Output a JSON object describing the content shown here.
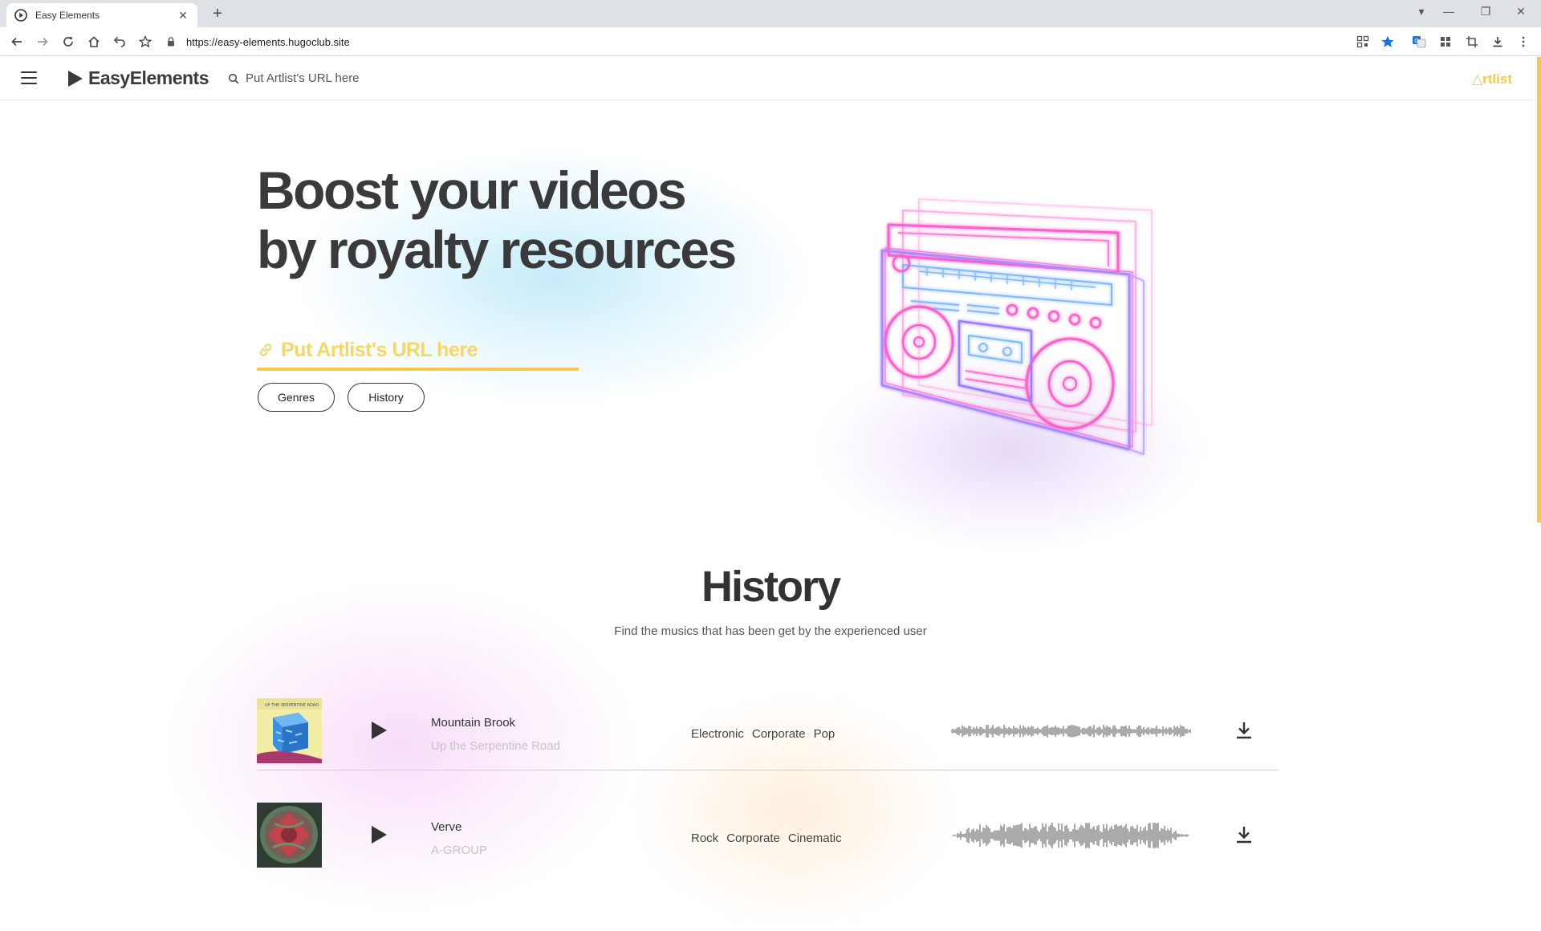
{
  "browser": {
    "tab_title": "Easy Elements",
    "url": "https://easy-elements.hugoclub.site"
  },
  "header": {
    "logo_text": "EasyElements",
    "search_placeholder": "Put Artlist's URL here",
    "artlist_label": "△rtlist"
  },
  "hero": {
    "title_line1": "Boost your videos",
    "title_line2": "by royalty resources",
    "input_placeholder": "Put Artlist's URL here",
    "genres_label": "Genres",
    "history_label": "History"
  },
  "history": {
    "title": "History",
    "subtitle": "Find the musics that has been get by the experienced user",
    "tracks": [
      {
        "title": "Mountain Brook",
        "artist": "Up the Serpentine Road",
        "tags": [
          "Electronic",
          "Corporate",
          "Pop"
        ]
      },
      {
        "title": "Verve",
        "artist": "A-GROUP",
        "tags": [
          "Rock",
          "Corporate",
          "Cinematic"
        ]
      }
    ]
  },
  "colors": {
    "accent_yellow": "#f2c94c",
    "title_dark": "#3a3a3a",
    "neon_pink": "#ff5fc8",
    "neon_purple": "#9b7bff",
    "neon_blue": "#7fb8ff"
  }
}
